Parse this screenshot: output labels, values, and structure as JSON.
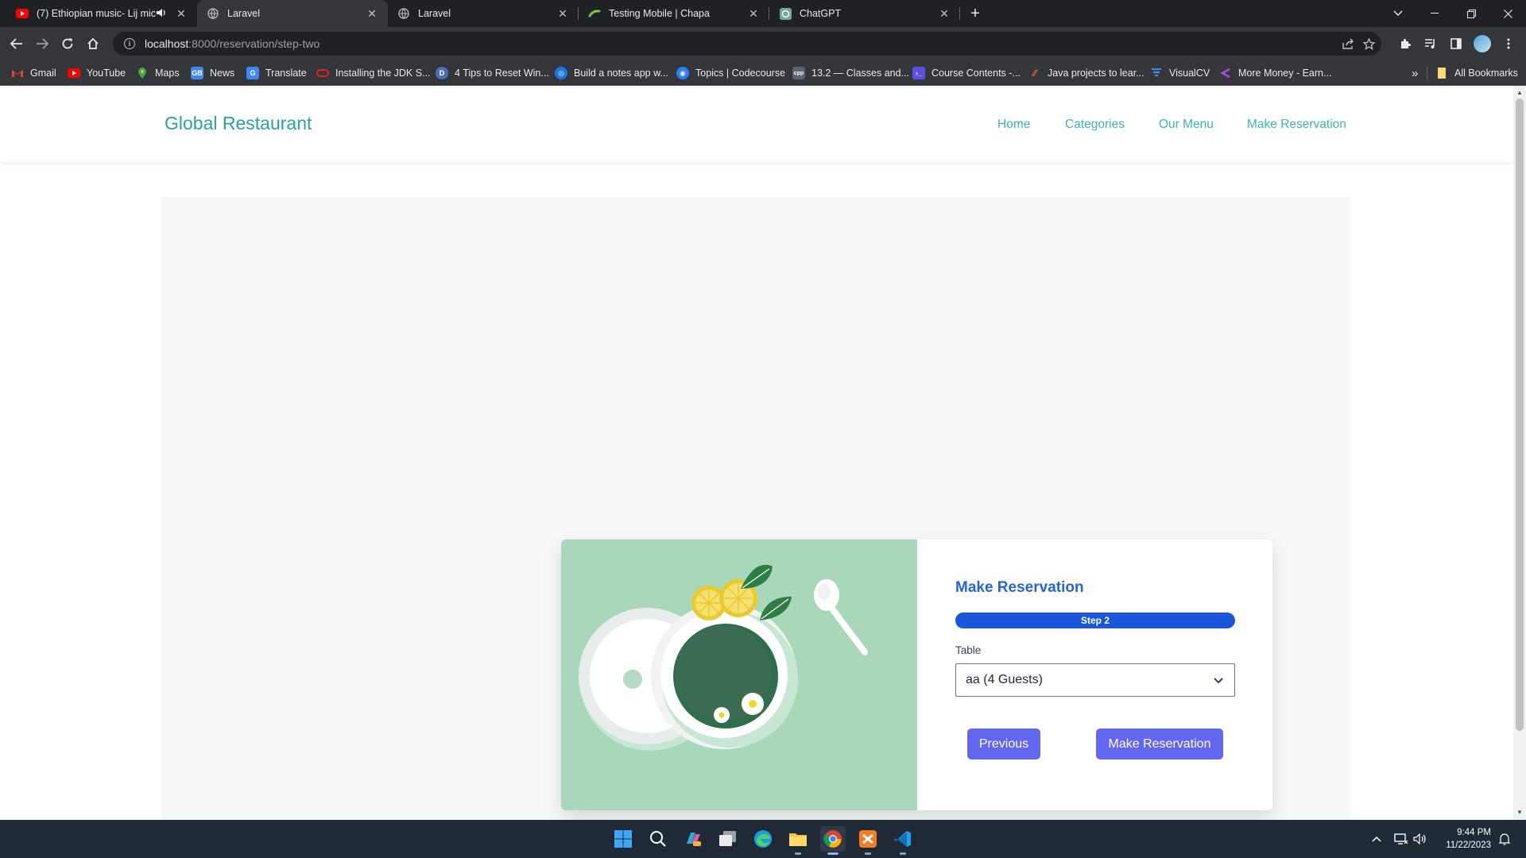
{
  "browser": {
    "tabs": [
      {
        "title": "(7) Ethiopian music- Lij mic",
        "favicon": "youtube-icon",
        "muted_icon": "speaker-icon"
      },
      {
        "title": "Laravel",
        "favicon": "globe-icon",
        "active": true
      },
      {
        "title": "Laravel",
        "favicon": "globe-icon"
      },
      {
        "title": "Testing Mobile | Chapa",
        "favicon": "chapa-icon"
      },
      {
        "title": "ChatGPT",
        "favicon": "chatgpt-icon"
      }
    ],
    "address": {
      "host": "localhost",
      "path": ":8000/reservation/step-two"
    },
    "bookmarks": [
      {
        "label": "Gmail",
        "icon": "gmail-icon"
      },
      {
        "label": "YouTube",
        "icon": "youtube-icon"
      },
      {
        "label": "Maps",
        "icon": "maps-icon"
      },
      {
        "label": "News",
        "icon": "news-icon"
      },
      {
        "label": "Translate",
        "icon": "translate-icon"
      },
      {
        "label": "Installing the JDK S...",
        "icon": "oracle-icon"
      },
      {
        "label": "4 Tips to Reset Win...",
        "icon": "bookmark-d-icon"
      },
      {
        "label": "Build a notes app w...",
        "icon": "bookmark-blue-icon"
      },
      {
        "label": "Topics | Codecourse",
        "icon": "codecourse-icon"
      },
      {
        "label": "13.2 — Classes and...",
        "icon": "cpp-icon"
      },
      {
        "label": "Course Contents -...",
        "icon": "course-icon"
      },
      {
        "label": "Java projects to lear...",
        "icon": "java-icon"
      },
      {
        "label": "VisualCV",
        "icon": "visualcv-icon"
      },
      {
        "label": "More Money - Earn...",
        "icon": "money-icon"
      }
    ],
    "all_bookmarks": "All Bookmarks",
    "overflow": "»"
  },
  "site": {
    "brand": "Global Restaurant",
    "nav": [
      "Home",
      "Categories",
      "Our Menu",
      "Make Reservation"
    ]
  },
  "reservation": {
    "title": "Make Reservation",
    "progress_label": "Step 2",
    "progress": 1.0,
    "table_label": "Table",
    "table_value": "aa (4 Guests)",
    "previous_label": "Previous",
    "submit_label": "Make Reservation"
  },
  "taskbar": {
    "time": "9:44 PM",
    "date": "11/22/2023"
  },
  "colors": {
    "brand": "#2aa39a",
    "nav_link": "#3fb2ad",
    "title": "#2563d6",
    "progress": "#1a56db",
    "button": "#6366f1",
    "image_bg": "#a8d8b9"
  }
}
